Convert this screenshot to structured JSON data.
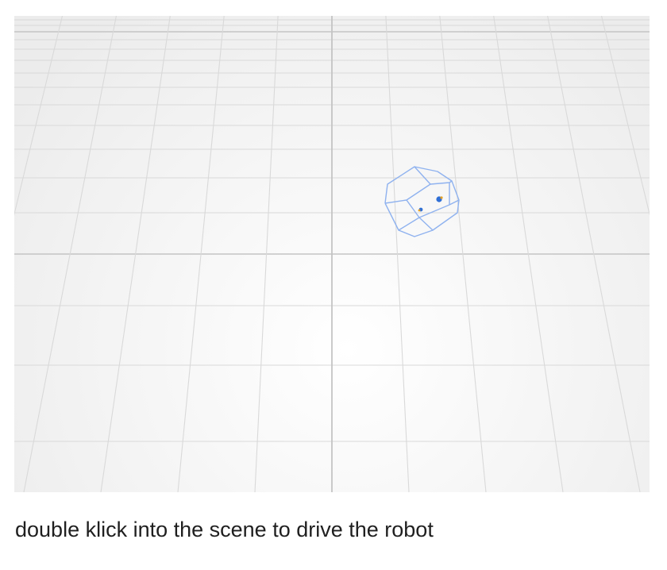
{
  "scene": {
    "kind": "3d-viewport",
    "background_center_color": "#ffffff",
    "background_edge_color": "#ececec",
    "grid_color": "#d9d9d9",
    "axis_color": "#c4c4c4",
    "robot_wireframe_color": "#8fb2ef",
    "robot_sensor_colors": [
      "#2f6fd6",
      "#e6a020"
    ]
  },
  "caption": {
    "text": "double klick into the scene to drive the robot"
  }
}
